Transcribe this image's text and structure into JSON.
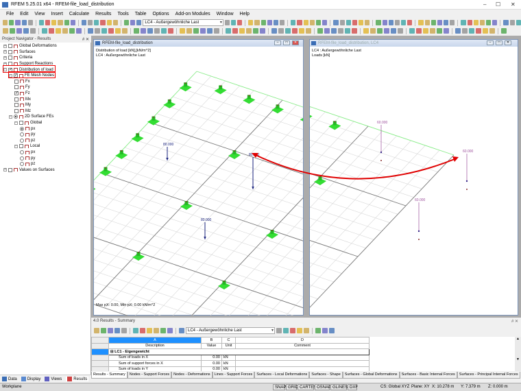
{
  "window": {
    "title": "RFEM 5.25.01 x64 - RFEM-file_load_distribution",
    "minimize": "–",
    "maximize": "☐",
    "close": "✕"
  },
  "menu": [
    "File",
    "Edit",
    "View",
    "Insert",
    "Calculate",
    "Results",
    "Tools",
    "Table",
    "Options",
    "Add-on Modules",
    "Window",
    "Help"
  ],
  "toolbar": {
    "load_case": "LC4 - Außergewöhnliche Last"
  },
  "navigator": {
    "title": "Project Navigator - Results",
    "pin": "# ✕",
    "items": [
      {
        "label": "Global Deformations",
        "level": 0,
        "control": "check",
        "checked": false
      },
      {
        "label": "Surfaces",
        "level": 0,
        "control": "check",
        "checked": false
      },
      {
        "label": "Criteria",
        "level": 0,
        "control": "check",
        "checked": false
      },
      {
        "label": "Support Reactions",
        "level": 0,
        "control": "check",
        "checked": false
      },
      {
        "label": "Distribution of load",
        "level": 0,
        "control": "check",
        "checked": true
      },
      {
        "label": "FE Mesh Nodes",
        "level": 1,
        "control": "check",
        "checked": true
      },
      {
        "label": "Fx",
        "level": 2,
        "control": "check",
        "checked": false
      },
      {
        "label": "Fy",
        "level": 2,
        "control": "check",
        "checked": false
      },
      {
        "label": "Fz",
        "level": 2,
        "control": "check",
        "checked": true
      },
      {
        "label": "Mx",
        "level": 2,
        "control": "check",
        "checked": false
      },
      {
        "label": "My",
        "level": 2,
        "control": "check",
        "checked": false
      },
      {
        "label": "Mz",
        "level": 2,
        "control": "check",
        "checked": false
      },
      {
        "label": "2D Surface FEs",
        "level": 1,
        "control": "radio",
        "checked": true
      },
      {
        "label": "Global",
        "level": 2,
        "control": "check",
        "checked": false
      },
      {
        "label": "px",
        "level": 3,
        "control": "radio",
        "checked": true
      },
      {
        "label": "py",
        "level": 3,
        "control": "radio",
        "checked": false
      },
      {
        "label": "pz",
        "level": 3,
        "control": "radio",
        "checked": false
      },
      {
        "label": "Local",
        "level": 2,
        "control": "check",
        "checked": false
      },
      {
        "label": "px",
        "level": 3,
        "control": "radio",
        "checked": false
      },
      {
        "label": "py",
        "level": 3,
        "control": "radio",
        "checked": false
      },
      {
        "label": "pz",
        "level": 3,
        "control": "radio",
        "checked": false
      },
      {
        "label": "Values on Surfaces",
        "level": 0,
        "control": "check",
        "checked": false
      }
    ],
    "tabs": [
      "Data",
      "Display",
      "Views",
      "Results"
    ]
  },
  "views": [
    {
      "title": "RFEM-file_load_distribution",
      "info": [
        "Distribution of load [kN],[kN/m^2]",
        "LC4 : Außergewöhnliche Last"
      ],
      "footer": "Max pX: 0.00, Min pX: 0.00 kN/m^2",
      "loads": [
        "80.000",
        "80.000",
        "80.000"
      ]
    },
    {
      "title": "RFEM-file_load_distribution, LC4",
      "info": [
        "LC4 : Außergewöhnliche Last",
        "Loads [kN]"
      ],
      "loads": [
        "60.000",
        "60.000",
        "60.000"
      ]
    }
  ],
  "results": {
    "title": "4.0 Results - Summary",
    "pin": "# ✕",
    "load_case": "LC4 - Außergewöhnliche Last",
    "columns": [
      "A",
      "B",
      "C",
      "D"
    ],
    "headers": [
      "Description",
      "Value",
      "Unit",
      "Comment"
    ],
    "group": "LC1 - Eigengewicht",
    "rows": [
      {
        "description": "Sum of loads in X",
        "value": "0.00",
        "unit": "kN"
      },
      {
        "description": "Sum of support forces in X",
        "value": "0.00",
        "unit": "kN"
      },
      {
        "description": "Sum of loads in Y",
        "value": "0.00",
        "unit": "kN"
      }
    ],
    "tabs": [
      "Results - Summary",
      "Nodes - Support Forces",
      "Nodes - Deformations",
      "Lines - Support Forces",
      "Surfaces - Local Deformations",
      "Surfaces - Shape",
      "Surfaces - Global Deformations",
      "Surfaces - Basic Internal Forces",
      "Surfaces - Principal Internal Forces"
    ]
  },
  "status": {
    "left": "Workplane",
    "toggles": [
      "SNAP",
      "GRID",
      "CARTES",
      "OSNAP",
      "GLINES",
      "DXF"
    ],
    "cs": "CS: Global XYZ",
    "plane": "Plane: XY",
    "x": "X: 10.278 m",
    "y": "Y: 7.379 m",
    "z": "Z: 0.000 m"
  },
  "colors": {
    "support": "#33dd33",
    "load_left": "#1a237e",
    "load_right": "#9c4f9c",
    "arrow": "#e00000"
  }
}
